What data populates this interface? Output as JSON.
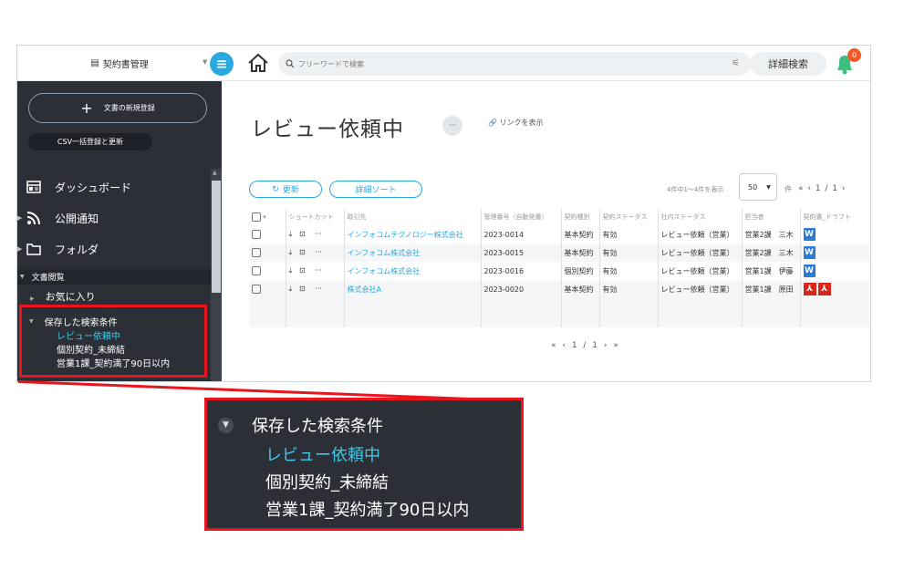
{
  "topbar": {
    "brand": "契約書管理",
    "search_placeholder": "フリーワードで検索",
    "advanced_search": "詳細検索",
    "notification_count": "0"
  },
  "sidebar": {
    "new_doc": "文書の新規登録",
    "csv": "CSV一括登録と更新",
    "nav": [
      {
        "label": "ダッシュボード"
      },
      {
        "label": "公開通知"
      },
      {
        "label": "フォルダ"
      }
    ],
    "section": "文書閲覧",
    "favorites": "お気に入り",
    "saved": {
      "title": "保存した検索条件",
      "items": [
        "レビュー依頼中",
        "個別契約_未締結",
        "営業1課_契約満了90日以内"
      ]
    }
  },
  "main": {
    "title": "レビュー依頼中",
    "more": "···",
    "link_show": "リンクを表示",
    "refresh": "更新",
    "detail_sort": "詳細ソート",
    "count_text": "4件中1〜4件を表示",
    "per_page": "50",
    "unit": "件",
    "pager": "«  ‹  1 / 1  ›",
    "pager_bottom": "«  ‹  1 / 1  ›  »",
    "columns": [
      "ショートカット",
      "取引先",
      "管理番号（自動発番）",
      "契約種別",
      "契約ステータス",
      "社内ステータス",
      "担当者",
      "契約書_ドラフト"
    ],
    "rows": [
      {
        "partner": "インフォコムテクノロジー株式会社",
        "no": "2023-0014",
        "type": "基本契約",
        "status": "有効",
        "internal": "レビュー依頼（営業）",
        "owner": "営業2課　三木",
        "file": "word"
      },
      {
        "partner": "インフォコム株式会社",
        "no": "2023-0015",
        "type": "基本契約",
        "status": "有効",
        "internal": "レビュー依頼（営業）",
        "owner": "営業2課　三木",
        "file": "word"
      },
      {
        "partner": "インフォコム株式会社",
        "no": "2023-0016",
        "type": "個別契約",
        "status": "有効",
        "internal": "レビュー依頼（営業）",
        "owner": "営業1課　伊藤",
        "file": "word"
      },
      {
        "partner": "株式会社A",
        "no": "2023-0020",
        "type": "基本契約",
        "status": "有効",
        "internal": "レビュー依頼（営業）",
        "owner": "営業1課　原田",
        "file": "pdf"
      }
    ]
  },
  "colors": {
    "accent": "#2aa8e0",
    "sidebar_bg": "#2c3036",
    "highlight": "#e8141e",
    "active_text": "#3cc8ec"
  }
}
